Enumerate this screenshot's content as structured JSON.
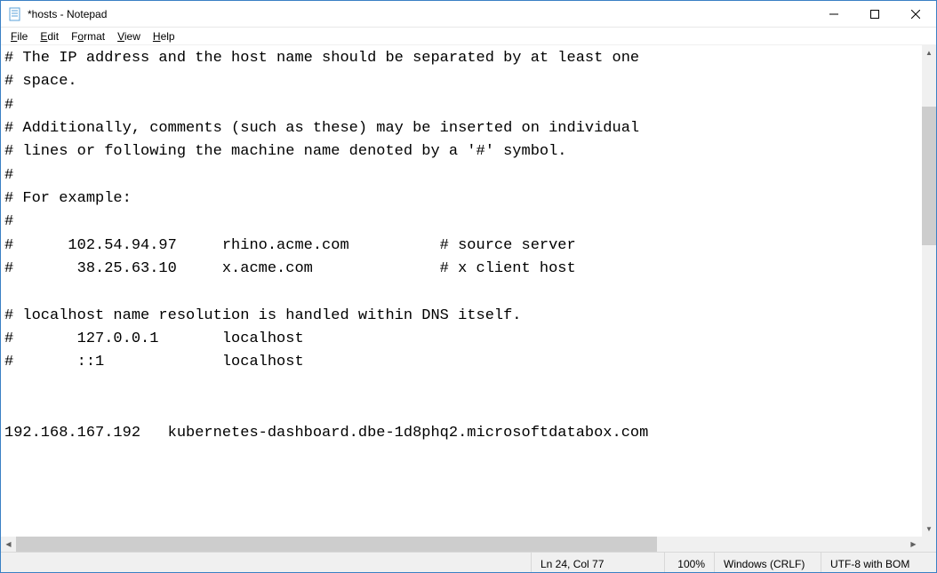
{
  "window": {
    "title": "*hosts - Notepad",
    "minimize_glyph": "—",
    "maximize_glyph": "☐",
    "close_glyph": "✕"
  },
  "menu": {
    "file": "File",
    "edit": "Edit",
    "format": "Format",
    "view": "View",
    "help": "Help"
  },
  "content": "# The IP address and the host name should be separated by at least one\n# space.\n#\n# Additionally, comments (such as these) may be inserted on individual\n# lines or following the machine name denoted by a '#' symbol.\n#\n# For example:\n#\n#      102.54.94.97     rhino.acme.com          # source server\n#       38.25.63.10     x.acme.com              # x client host\n\n# localhost name resolution is handled within DNS itself.\n#       127.0.0.1       localhost\n#       ::1             localhost\n\n\n192.168.167.192   kubernetes-dashboard.dbe-1d8phq2.microsoftdatabox.com",
  "status": {
    "position": "Ln 24, Col 77",
    "zoom": "100%",
    "line_ending": "Windows (CRLF)",
    "encoding": "UTF-8 with BOM"
  },
  "scroll": {
    "up": "▲",
    "down": "▼",
    "left": "◀",
    "right": "▶"
  }
}
